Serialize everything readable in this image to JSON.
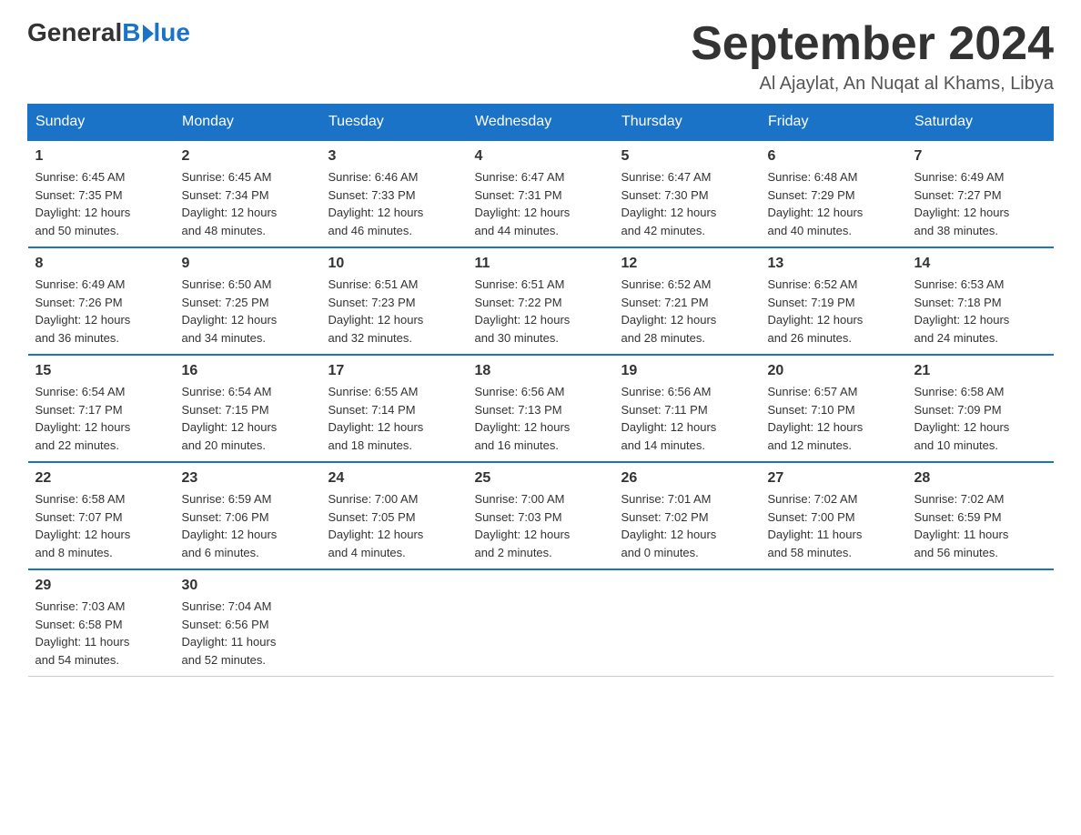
{
  "logo": {
    "general": "General",
    "blue": "Blue"
  },
  "title": "September 2024",
  "subtitle": "Al Ajaylat, An Nuqat al Khams, Libya",
  "days_of_week": [
    "Sunday",
    "Monday",
    "Tuesday",
    "Wednesday",
    "Thursday",
    "Friday",
    "Saturday"
  ],
  "weeks": [
    [
      {
        "day": "1",
        "sunrise": "6:45 AM",
        "sunset": "7:35 PM",
        "daylight": "12 hours and 50 minutes."
      },
      {
        "day": "2",
        "sunrise": "6:45 AM",
        "sunset": "7:34 PM",
        "daylight": "12 hours and 48 minutes."
      },
      {
        "day": "3",
        "sunrise": "6:46 AM",
        "sunset": "7:33 PM",
        "daylight": "12 hours and 46 minutes."
      },
      {
        "day": "4",
        "sunrise": "6:47 AM",
        "sunset": "7:31 PM",
        "daylight": "12 hours and 44 minutes."
      },
      {
        "day": "5",
        "sunrise": "6:47 AM",
        "sunset": "7:30 PM",
        "daylight": "12 hours and 42 minutes."
      },
      {
        "day": "6",
        "sunrise": "6:48 AM",
        "sunset": "7:29 PM",
        "daylight": "12 hours and 40 minutes."
      },
      {
        "day": "7",
        "sunrise": "6:49 AM",
        "sunset": "7:27 PM",
        "daylight": "12 hours and 38 minutes."
      }
    ],
    [
      {
        "day": "8",
        "sunrise": "6:49 AM",
        "sunset": "7:26 PM",
        "daylight": "12 hours and 36 minutes."
      },
      {
        "day": "9",
        "sunrise": "6:50 AM",
        "sunset": "7:25 PM",
        "daylight": "12 hours and 34 minutes."
      },
      {
        "day": "10",
        "sunrise": "6:51 AM",
        "sunset": "7:23 PM",
        "daylight": "12 hours and 32 minutes."
      },
      {
        "day": "11",
        "sunrise": "6:51 AM",
        "sunset": "7:22 PM",
        "daylight": "12 hours and 30 minutes."
      },
      {
        "day": "12",
        "sunrise": "6:52 AM",
        "sunset": "7:21 PM",
        "daylight": "12 hours and 28 minutes."
      },
      {
        "day": "13",
        "sunrise": "6:52 AM",
        "sunset": "7:19 PM",
        "daylight": "12 hours and 26 minutes."
      },
      {
        "day": "14",
        "sunrise": "6:53 AM",
        "sunset": "7:18 PM",
        "daylight": "12 hours and 24 minutes."
      }
    ],
    [
      {
        "day": "15",
        "sunrise": "6:54 AM",
        "sunset": "7:17 PM",
        "daylight": "12 hours and 22 minutes."
      },
      {
        "day": "16",
        "sunrise": "6:54 AM",
        "sunset": "7:15 PM",
        "daylight": "12 hours and 20 minutes."
      },
      {
        "day": "17",
        "sunrise": "6:55 AM",
        "sunset": "7:14 PM",
        "daylight": "12 hours and 18 minutes."
      },
      {
        "day": "18",
        "sunrise": "6:56 AM",
        "sunset": "7:13 PM",
        "daylight": "12 hours and 16 minutes."
      },
      {
        "day": "19",
        "sunrise": "6:56 AM",
        "sunset": "7:11 PM",
        "daylight": "12 hours and 14 minutes."
      },
      {
        "day": "20",
        "sunrise": "6:57 AM",
        "sunset": "7:10 PM",
        "daylight": "12 hours and 12 minutes."
      },
      {
        "day": "21",
        "sunrise": "6:58 AM",
        "sunset": "7:09 PM",
        "daylight": "12 hours and 10 minutes."
      }
    ],
    [
      {
        "day": "22",
        "sunrise": "6:58 AM",
        "sunset": "7:07 PM",
        "daylight": "12 hours and 8 minutes."
      },
      {
        "day": "23",
        "sunrise": "6:59 AM",
        "sunset": "7:06 PM",
        "daylight": "12 hours and 6 minutes."
      },
      {
        "day": "24",
        "sunrise": "7:00 AM",
        "sunset": "7:05 PM",
        "daylight": "12 hours and 4 minutes."
      },
      {
        "day": "25",
        "sunrise": "7:00 AM",
        "sunset": "7:03 PM",
        "daylight": "12 hours and 2 minutes."
      },
      {
        "day": "26",
        "sunrise": "7:01 AM",
        "sunset": "7:02 PM",
        "daylight": "12 hours and 0 minutes."
      },
      {
        "day": "27",
        "sunrise": "7:02 AM",
        "sunset": "7:00 PM",
        "daylight": "11 hours and 58 minutes."
      },
      {
        "day": "28",
        "sunrise": "7:02 AM",
        "sunset": "6:59 PM",
        "daylight": "11 hours and 56 minutes."
      }
    ],
    [
      {
        "day": "29",
        "sunrise": "7:03 AM",
        "sunset": "6:58 PM",
        "daylight": "11 hours and 54 minutes."
      },
      {
        "day": "30",
        "sunrise": "7:04 AM",
        "sunset": "6:56 PM",
        "daylight": "11 hours and 52 minutes."
      },
      null,
      null,
      null,
      null,
      null
    ]
  ],
  "labels": {
    "sunrise": "Sunrise:",
    "sunset": "Sunset:",
    "daylight": "Daylight:"
  }
}
